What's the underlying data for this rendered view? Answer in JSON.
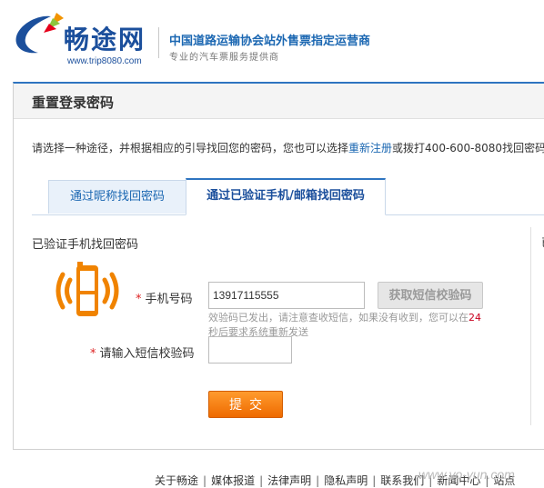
{
  "header": {
    "logo_text": "畅途网",
    "logo_url": "www.trip8080.com",
    "slogan_main": "中国道路运输协会站外售票指定运营商",
    "slogan_sub": "专业的汽车票服务提供商"
  },
  "page_title": "重置登录密码",
  "intro": {
    "prefix": "请选择一种途径，并根据相应的引导找回您的密码，您也可以选择",
    "link": "重新注册",
    "middle": "或拨打",
    "phone": "400-600-8080",
    "suffix": "找回密码。"
  },
  "tabs": [
    {
      "label": "通过昵称找回密码",
      "active": false
    },
    {
      "label": "通过已验证手机/邮箱找回密码",
      "active": true
    }
  ],
  "section_title": "已验证手机找回密码",
  "side_text": "已",
  "form": {
    "phone_label": "手机号码",
    "phone_value": "13917115555",
    "sms_button": "获取短信校验码",
    "hint_prefix": "效验码已发出，请注意查收短信，如果没有收到，您可以在",
    "hint_seconds": "24",
    "hint_suffix": "秒后要求系统重新发送",
    "code_label": "请输入短信校验码",
    "code_value": "",
    "required_mark": "*",
    "submit_label": "提交"
  },
  "footer": {
    "links": [
      "关于畅途",
      "媒体报道",
      "法律声明",
      "隐私声明",
      "联系我们",
      "新闻中心",
      "站点"
    ],
    "separator": "|",
    "watermark": "www.yo-yun.com"
  },
  "colors": {
    "brand_blue": "#1b4f9c",
    "link_blue": "#1b67b2",
    "submit_orange": "#ee6a00",
    "countdown_red": "#c8001e"
  }
}
